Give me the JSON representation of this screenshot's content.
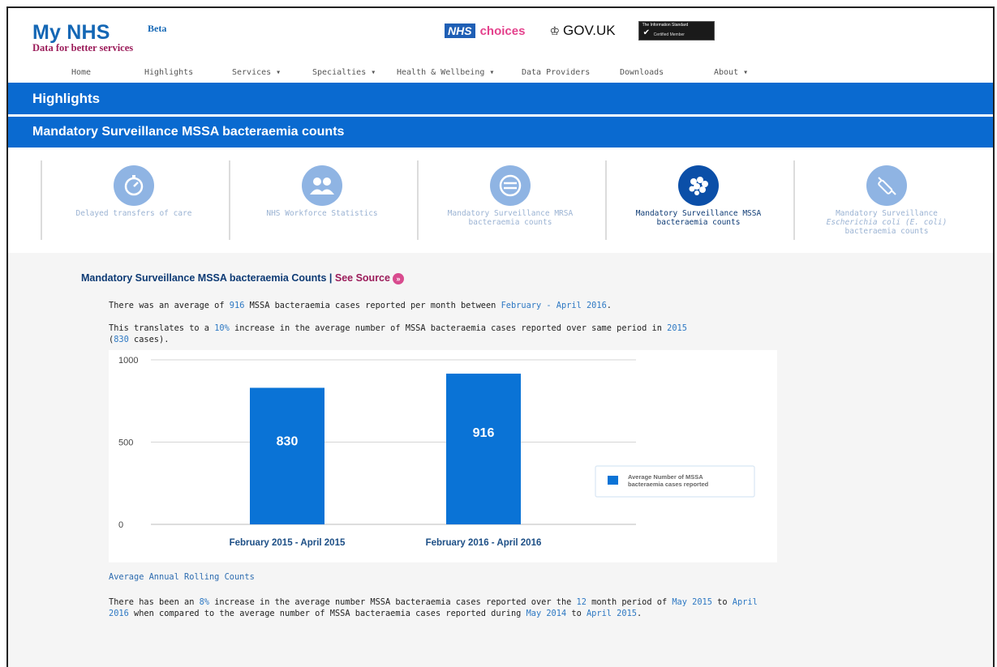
{
  "header": {
    "title": "My NHS",
    "beta": "Beta",
    "subtitle": "Data for better services",
    "nhs_box": "NHS",
    "choices": "choices",
    "govuk": "GOV.UK",
    "info_std_line1": "The Information Standard",
    "info_std_line2": "Certified Member"
  },
  "nav": {
    "items": [
      {
        "label": "Home"
      },
      {
        "label": "Highlights"
      },
      {
        "label": "Services ▾"
      },
      {
        "label": "Specialties ▾"
      },
      {
        "label": "Health & Wellbeing ▾"
      },
      {
        "label": "Data Providers"
      },
      {
        "label": "Downloads"
      },
      {
        "label": "About ▾"
      }
    ]
  },
  "banner": {
    "section": "Highlights",
    "page_title": "Mandatory Surveillance MSSA bacteraemia counts"
  },
  "tiles": [
    {
      "label": "Delayed transfers of care",
      "icon": "stopwatch-icon",
      "active": false
    },
    {
      "label": "NHS Workforce Statistics",
      "icon": "people-icon",
      "active": false
    },
    {
      "label": "Mandatory Surveillance MRSA bacteraemia counts",
      "icon": "capsule-icon",
      "active": false
    },
    {
      "label": "Mandatory Surveillance MSSA bacteraemia counts",
      "icon": "bacteria-cluster-icon",
      "active": true
    },
    {
      "label_pre": "Mandatory Surveillance",
      "label_italic": "Escherichia coli (E. coli)",
      "label_post": "bacteraemia counts",
      "icon": "syringe-icon",
      "active": false
    }
  ],
  "main": {
    "section_title": "Mandatory Surveillance MSSA bacteraemia Counts",
    "separator": "|",
    "see_source": "See Source",
    "p1": {
      "t1": "There was an average of ",
      "v1": "916",
      "t2": " MSSA bacteraemia cases reported per month between ",
      "v2": "February - April 2016",
      "t3": "."
    },
    "p2": {
      "t1": "This translates to a ",
      "v1": "10%",
      "t2": " increase in the average number of MSSA bacteraemia cases reported over same period in ",
      "v2": "2015",
      "t3": "(",
      "v3": "830",
      "t4": " cases)."
    },
    "rolling_title": "Average Annual Rolling Counts",
    "p3": {
      "t1": "There has been an ",
      "v1": "8%",
      "t2": " increase in the average number MSSA bacteraemia cases reported over the ",
      "v2": "12",
      "t3": " month period of ",
      "v3": "May 2015",
      "t4": " to ",
      "v4": "April 2016",
      "t5": " when compared to the average number of MSSA bacteraemia cases reported during ",
      "v5": "May 2014",
      "t6": " to ",
      "v6": "April 2015",
      "t7": "."
    }
  },
  "colors": {
    "brand_blue": "#0a6ad0",
    "bar_blue": "#0a73d6",
    "tile_inactive": "#8fb4e3",
    "tile_active": "#0b4fa8",
    "magenta": "#9b1c5a",
    "link_blue": "#2d78c3"
  },
  "chart_data": {
    "type": "bar",
    "categories": [
      "February 2015 - April 2015",
      "February 2016 - April 2016"
    ],
    "series": [
      {
        "name": "Average Number of MSSA bacteraemia cases reported",
        "values": [
          830,
          916
        ]
      }
    ],
    "data_labels": [
      "830",
      "916"
    ],
    "yticks": [
      0,
      500,
      1000
    ],
    "ylim": [
      0,
      1000
    ],
    "legend_position": "right",
    "grid": true
  }
}
